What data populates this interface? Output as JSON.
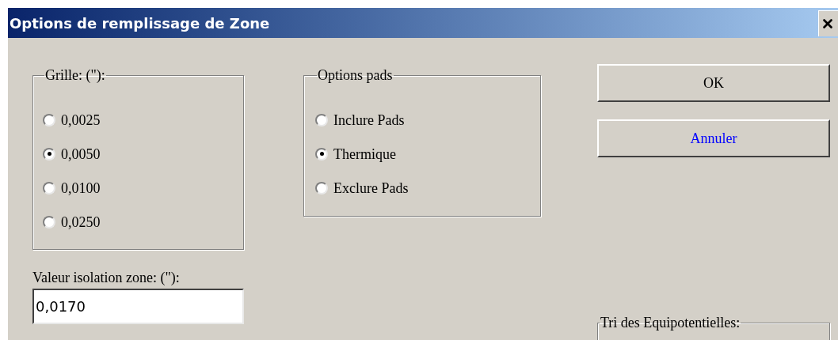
{
  "window": {
    "title": "Options de remplissage de Zone"
  },
  "grid_group": {
    "title": "Grille: (\"):",
    "options": [
      {
        "label": "0,0025",
        "selected": false
      },
      {
        "label": "0,0050",
        "selected": true
      },
      {
        "label": "0,0100",
        "selected": false
      },
      {
        "label": "0,0250",
        "selected": false
      }
    ]
  },
  "isolation": {
    "label": "Valeur isolation zone: (\"):",
    "value": "0,0170"
  },
  "pads_group": {
    "title": "Options pads",
    "options": [
      {
        "label": "Inclure Pads",
        "selected": false
      },
      {
        "label": "Thermique",
        "selected": true
      },
      {
        "label": "Exclure Pads",
        "selected": false
      }
    ]
  },
  "buttons": [
    {
      "label": "OK",
      "color": "#000000"
    },
    {
      "label": "Annuler",
      "color": "#0000ff"
    }
  ],
  "net_sort_group": {
    "title": "Tri des Equipotentielles:"
  }
}
